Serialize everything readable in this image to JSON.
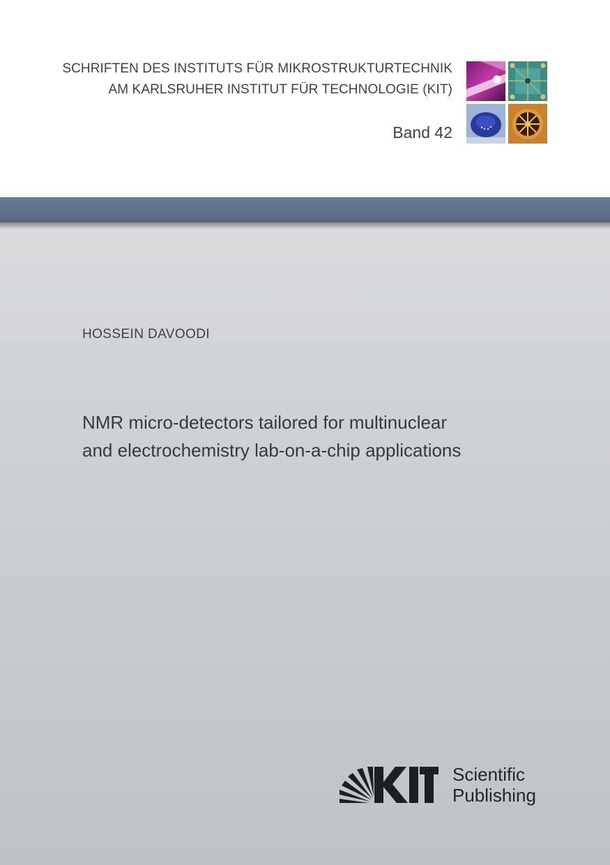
{
  "series": {
    "line1": "SCHRIFTEN DES INSTITUTS FÜR MIKROSTRUKTURTECHNIK",
    "line2": "AM KARLSRUHER INSTITUT FÜR TECHNOLOGIE (KIT)",
    "band": "Band 42"
  },
  "author": "HOSSEIN DAVOODI",
  "title": {
    "line1": "NMR micro-detectors tailored for multinuclear",
    "line2": "and electrochemistry lab-on-a-chip applications"
  },
  "publisher": {
    "line1": "Scientific",
    "line2": "Publishing"
  },
  "colors": {
    "header_bar": "#5f6f88",
    "background": "#cfd2d5",
    "text": "#3c4149"
  }
}
